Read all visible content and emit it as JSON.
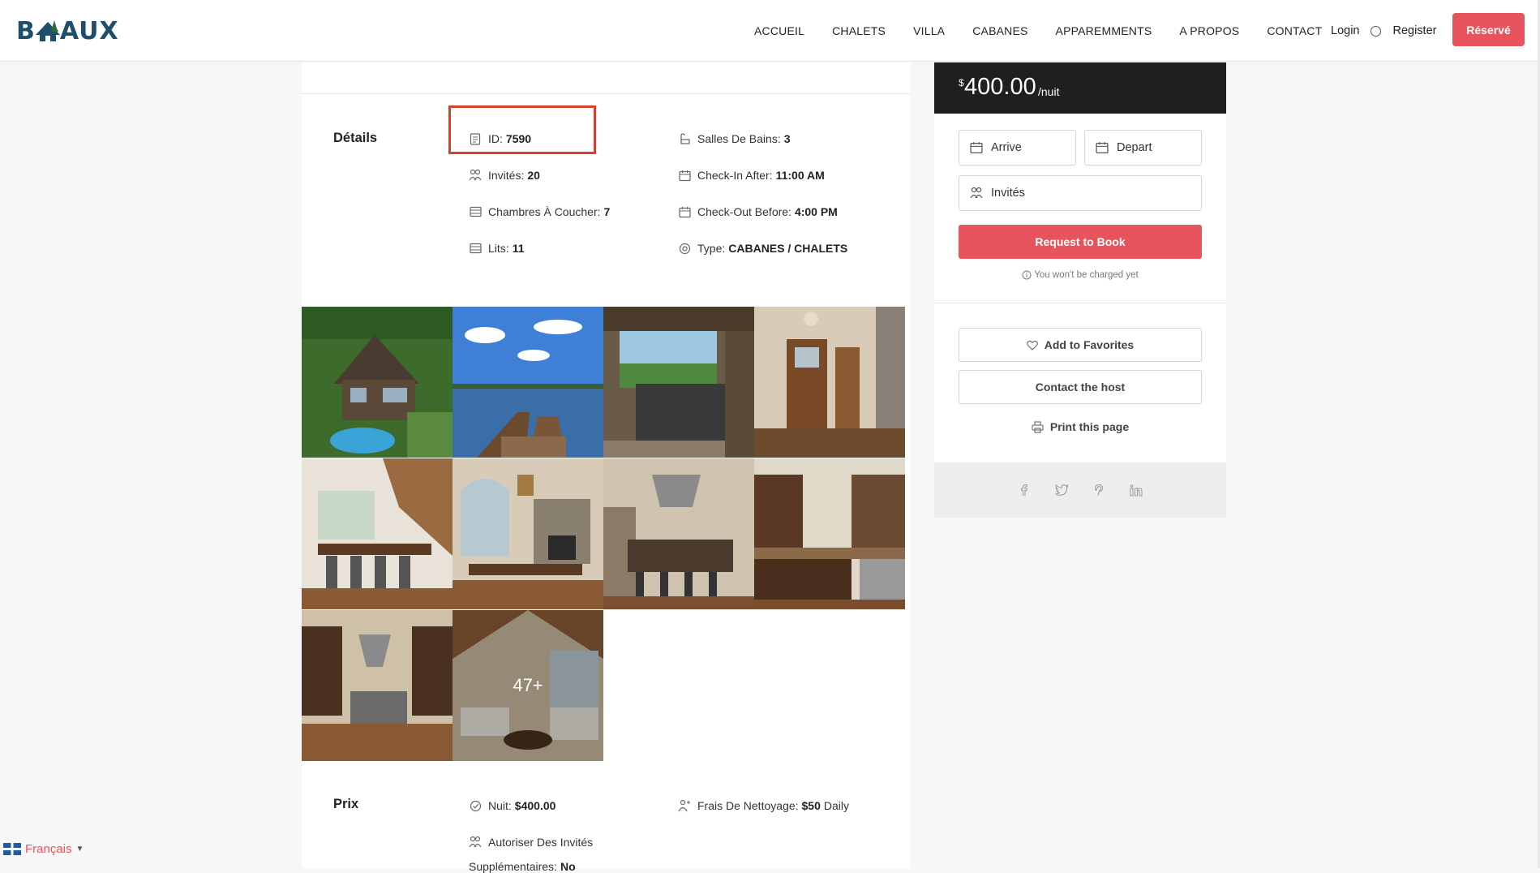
{
  "header": {
    "logo_text": "BAAUX",
    "nav": [
      "ACCUEIL",
      "CHALETS",
      "VILLA",
      "CABANES",
      "APPAREMMENTS",
      "A PROPOS",
      "CONTACT"
    ],
    "login": "Login",
    "register": "Register",
    "reserve": "Réservé"
  },
  "details": {
    "label": "Détails",
    "id_label": "ID:",
    "id_value": "7590",
    "guests_label": "Invités:",
    "guests_value": "20",
    "bedrooms_label": "Chambres À Coucher:",
    "bedrooms_value": "7",
    "beds_label": "Lits:",
    "beds_value": "11",
    "baths_label": "Salles De Bains:",
    "baths_value": "3",
    "checkin_label": "Check-In After:",
    "checkin_value": "11:00 AM",
    "checkout_label": "Check-Out Before:",
    "checkout_value": "4:00 PM",
    "type_label": "Type:",
    "type_value": "CABANES / CHALETS"
  },
  "gallery": {
    "more_label": "47+",
    "photos": [
      "aerial-chalet-pool",
      "lake-dock-chairs",
      "hot-tub-deck",
      "entry-door-hall",
      "dining-staircase",
      "dining-fireplace",
      "kitchen-island-bar",
      "kitchen-counter",
      "kitchen-range",
      "living-room"
    ]
  },
  "pricing": {
    "label": "Prix",
    "night_label": "Nuit:",
    "night_value": "$400.00",
    "cleaning_label": "Frais De Nettoyage:",
    "cleaning_value": "$50",
    "cleaning_unit": "Daily",
    "extra_guests_label": "Autoriser Des Invités",
    "extra_guests_label2": "Supplémentaires:",
    "extra_guests_value": "No"
  },
  "booking": {
    "currency": "$",
    "price": "400.00",
    "per": "/nuit",
    "arrive_placeholder": "Arrive",
    "depart_placeholder": "Depart",
    "guests_placeholder": "Invités",
    "request_button": "Request to Book",
    "note": "You won't be charged yet",
    "favorites": "Add to Favorites",
    "contact_host": "Contact the host",
    "print": "Print this page"
  },
  "share_icons": [
    "facebook-icon",
    "twitter-icon",
    "pinterest-icon",
    "linkedin-icon"
  ],
  "language": {
    "label": "Français"
  },
  "colors": {
    "accent": "#e8545d",
    "dark": "#1f1f1f",
    "highlight": "#d9412f",
    "logo": "#1f4e6b"
  }
}
